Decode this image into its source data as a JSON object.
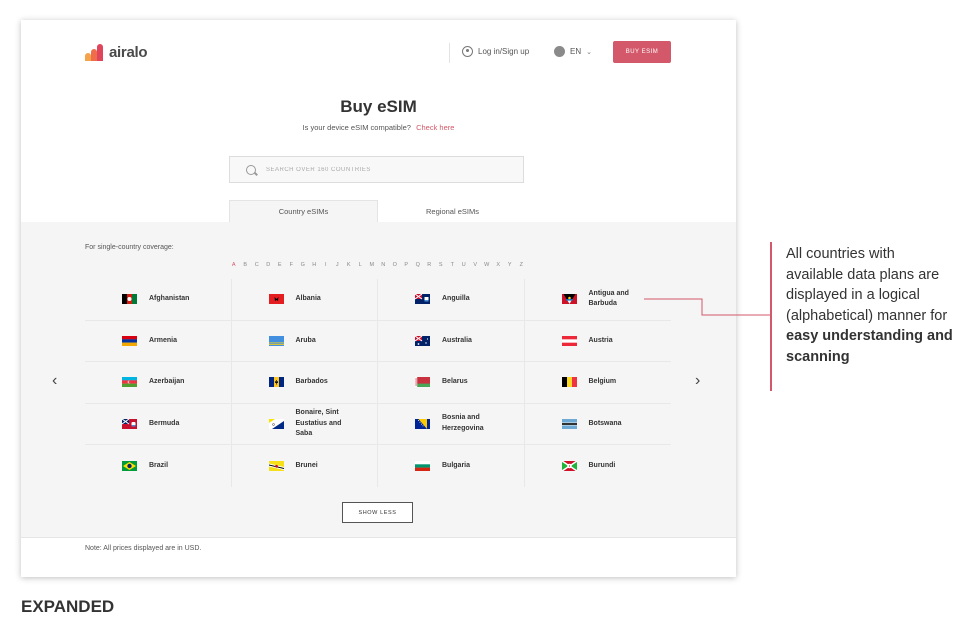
{
  "header": {
    "brand": "airalo",
    "login_label": "Log in/Sign up",
    "lang_label": "EN",
    "buy_label": "BUY ESIM"
  },
  "page": {
    "title": "Buy eSIM",
    "subtitle": "Is your device eSIM compatible?",
    "check_link": "Check here",
    "search_placeholder": "SEARCH OVER 160 COUNTRIES"
  },
  "tabs": [
    {
      "label": "Country eSIMs",
      "active": true
    },
    {
      "label": "Regional eSIMs",
      "active": false
    }
  ],
  "section": {
    "coverage_label": "For single-country coverage:",
    "letters": [
      "A",
      "B",
      "C",
      "D",
      "E",
      "F",
      "G",
      "H",
      "I",
      "J",
      "K",
      "L",
      "M",
      "N",
      "O",
      "P",
      "Q",
      "R",
      "S",
      "T",
      "U",
      "V",
      "W",
      "X",
      "Y",
      "Z"
    ],
    "active_letter": "A",
    "countries": [
      {
        "name": "Afghanistan",
        "flag": "afghanistan-flag"
      },
      {
        "name": "Albania",
        "flag": "albania-flag"
      },
      {
        "name": "Anguilla",
        "flag": "anguilla-flag"
      },
      {
        "name": "Antigua and Barbuda",
        "flag": "antigua-flag"
      },
      {
        "name": "Armenia",
        "flag": "armenia-flag"
      },
      {
        "name": "Aruba",
        "flag": "aruba-flag"
      },
      {
        "name": "Australia",
        "flag": "australia-flag"
      },
      {
        "name": "Austria",
        "flag": "austria-flag"
      },
      {
        "name": "Azerbaijan",
        "flag": "azerbaijan-flag"
      },
      {
        "name": "Barbados",
        "flag": "barbados-flag"
      },
      {
        "name": "Belarus",
        "flag": "belarus-flag"
      },
      {
        "name": "Belgium",
        "flag": "belgium-flag"
      },
      {
        "name": "Bermuda",
        "flag": "bermuda-flag"
      },
      {
        "name": "Bonaire, Sint Eustatius and Saba",
        "flag": "bonaire-flag"
      },
      {
        "name": "Bosnia and Herzegovina",
        "flag": "bosnia-flag"
      },
      {
        "name": "Botswana",
        "flag": "botswana-flag"
      },
      {
        "name": "Brazil",
        "flag": "brazil-flag"
      },
      {
        "name": "Brunei",
        "flag": "brunei-flag"
      },
      {
        "name": "Bulgaria",
        "flag": "bulgaria-flag"
      },
      {
        "name": "Burundi",
        "flag": "burundi-flag"
      }
    ],
    "show_less_label": "SHOW LESS"
  },
  "footer_note": "Note: All prices displayed are in USD.",
  "caption": "EXPANDED",
  "annotation": {
    "text_plain": "All countries with available data plans are displayed in a logical (alphabetical) manner for ",
    "text_bold": "easy understanding and scanning"
  },
  "colors": {
    "accent": "#d35869",
    "section_bg": "#f5f5f5"
  }
}
